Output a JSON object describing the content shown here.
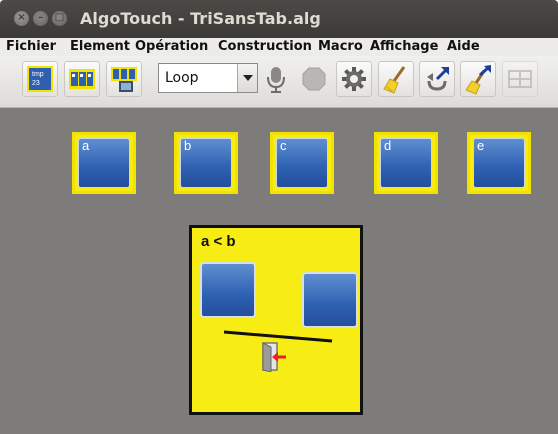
{
  "window": {
    "title": "AlgoTouch - TriSansTab.alg",
    "close_glyph": "×",
    "minimize_glyph": "–",
    "maximize_glyph": "□"
  },
  "menu": {
    "items": [
      "Fichier",
      "Element",
      "Opération",
      "Construction",
      "Macro",
      "Affichage",
      "Aide"
    ]
  },
  "toolbar": {
    "new_variable_icon_text": "tmp\n23",
    "tools": [
      {
        "icon": "new-variable-icon"
      },
      {
        "icon": "new-array-icon"
      },
      {
        "icon": "new-memory-icon"
      },
      {
        "icon": "microphone-icon"
      },
      {
        "icon": "record-stop-icon"
      },
      {
        "icon": "gear-icon"
      },
      {
        "icon": "broom-icon"
      },
      {
        "icon": "undo-arrow-icon"
      },
      {
        "icon": "clean-arrow-icon"
      },
      {
        "icon": "disabled-tool-icon"
      }
    ],
    "loop_select": {
      "value": "Loop"
    }
  },
  "canvas": {
    "variables": [
      {
        "name": "a"
      },
      {
        "name": "b"
      },
      {
        "name": "c"
      },
      {
        "name": "d"
      },
      {
        "name": "e"
      }
    ],
    "comparison": {
      "expression": "a < b"
    }
  },
  "colors": {
    "canvas_bg": "#7d7c7a",
    "variable_frame": "#f2e200",
    "variable_fill": "#2e60b2",
    "comparison_bg": "#f7ec14",
    "exit_arrow": "#e8202b"
  }
}
